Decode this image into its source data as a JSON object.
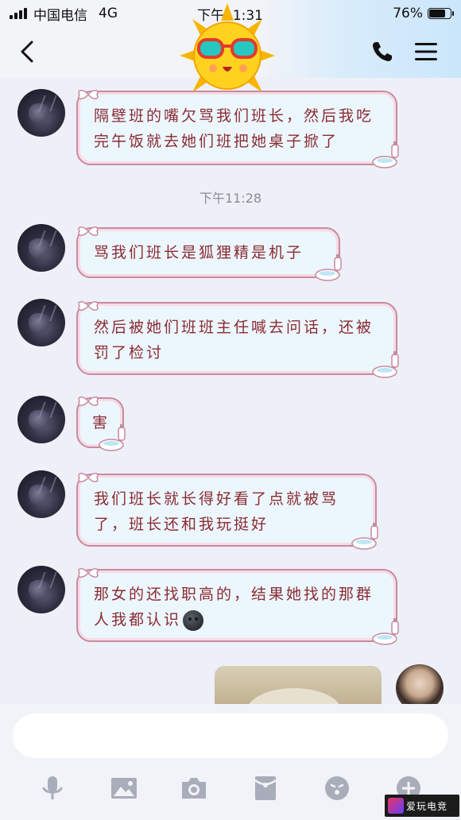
{
  "status_bar": {
    "carrier": "中国电信",
    "network": "4G",
    "time": "下午11:31",
    "battery_text": "76%",
    "battery_level": 0.76
  },
  "header": {
    "back_icon": "chevron-left-icon",
    "call_icon": "phone-icon",
    "menu_icon": "menu-icon",
    "sticker": "sun-sunglasses-sticker"
  },
  "messages": [
    {
      "sender": "other",
      "text": "隔壁班的嘴欠骂我们班长，然后我吃完午饭就去她们班把她桌子掀了"
    },
    {
      "sender": "other",
      "text": "骂我们班长是狐狸精是机子"
    },
    {
      "sender": "other",
      "text": "然后被她们班班主任喊去问话，还被罚了检讨"
    },
    {
      "sender": "other",
      "text": "害"
    },
    {
      "sender": "other",
      "text": "我们班长就长得好看了点就被骂了，班长还和我玩挺好"
    },
    {
      "sender": "other",
      "text": "那女的还找职高的，结果她找的那群人我都认识"
    }
  ],
  "timestamp": "下午11:28",
  "input": {
    "value": "",
    "placeholder": ""
  },
  "toolbar": [
    {
      "icon": "microphone-icon"
    },
    {
      "icon": "image-icon"
    },
    {
      "icon": "camera-icon"
    },
    {
      "icon": "red-packet-icon"
    },
    {
      "icon": "emoji-icon"
    },
    {
      "icon": "plus-icon"
    }
  ],
  "watermark": {
    "text": "爱玩电竞"
  },
  "colors": {
    "bubble_text": "#8b2b32",
    "bubble_bg": "#ecf6fd",
    "bubble_border": "#c78aa0"
  }
}
